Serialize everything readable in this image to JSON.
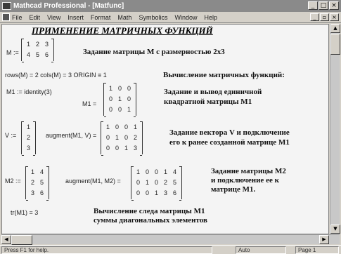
{
  "window": {
    "title": "Mathcad Professional - [Matfunc]",
    "buttons": {
      "minimize": "_",
      "maximize": "□",
      "close": "×"
    }
  },
  "menu": {
    "items": [
      "File",
      "Edit",
      "View",
      "Insert",
      "Format",
      "Math",
      "Symbolics",
      "Window",
      "Help"
    ],
    "doc_buttons": {
      "minimize": "_",
      "restore": "▫",
      "close": "×"
    }
  },
  "worksheet": {
    "heading": "ПРИМЕНЕНИЕ МАТРИЧНЫХ ФУНКЦИЙ",
    "block1": {
      "lhs": "M :=",
      "matrix": [
        [
          "1",
          "2",
          "3"
        ],
        [
          "4",
          "5",
          "6"
        ]
      ],
      "desc": "Задание матрицы M с размерностью 2x3"
    },
    "block2": {
      "expr": "rows(M) = 2   cols(M) = 3   ORIGIN ≡ 1",
      "desc": "Вычисление матричных функций:"
    },
    "block3": {
      "expr1": "M1 := identity(3)",
      "lhs2": "M1 =",
      "matrix": [
        [
          "1",
          "0",
          "0"
        ],
        [
          "0",
          "1",
          "0"
        ],
        [
          "0",
          "0",
          "1"
        ]
      ],
      "desc_line1": "Задание и вывод единичной",
      "desc_line2": "квадратной матрицы M1"
    },
    "block4": {
      "lhs": "V :=",
      "vector": [
        [
          "1"
        ],
        [
          "2"
        ],
        [
          "3"
        ]
      ],
      "expr": "augment(M1, V) =",
      "matrix": [
        [
          "1",
          "0",
          "0",
          "1"
        ],
        [
          "0",
          "1",
          "0",
          "2"
        ],
        [
          "0",
          "0",
          "1",
          "3"
        ]
      ],
      "desc_line1": "Задание вектора V и подключение",
      "desc_line2": "его к ранее созданной матрице M1"
    },
    "block5": {
      "lhs": "M2 :=",
      "matrix1": [
        [
          "1",
          "4"
        ],
        [
          "2",
          "5"
        ],
        [
          "3",
          "6"
        ]
      ],
      "expr": "augment(M1, M2) =",
      "matrix2": [
        [
          "1",
          "0",
          "0",
          "1",
          "4"
        ],
        [
          "0",
          "1",
          "0",
          "2",
          "5"
        ],
        [
          "0",
          "0",
          "1",
          "3",
          "6"
        ]
      ],
      "desc_line1": "Задание матрицы M2",
      "desc_line2": "и подключение ее к",
      "desc_line3": "матрице M1."
    },
    "block6": {
      "expr": "tr(M1) = 3",
      "desc_line1": "Вычисление следа матрицы M1",
      "desc_line2": "суммы диагональных элементов"
    }
  },
  "status": {
    "help": "Press F1 for help.",
    "mode": "Auto",
    "page": "Page 1"
  }
}
